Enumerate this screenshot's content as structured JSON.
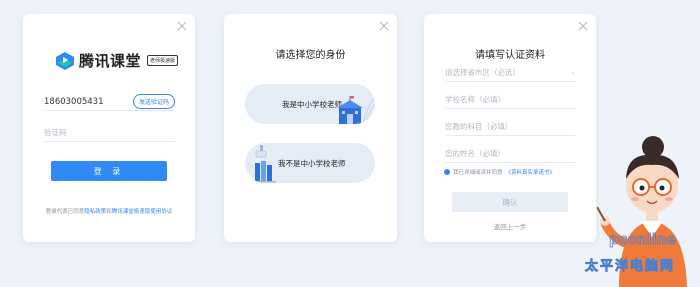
{
  "card_login": {
    "brand": "腾讯课堂",
    "badge": "老师极速版",
    "phone_value": "18603005431",
    "send_code_label": "发送验证码",
    "code_placeholder": "验证码",
    "login_label": "登 录",
    "agreement_prefix": "登录代表已同意",
    "privacy_link": "隐私政策",
    "and": "和",
    "service_link": "腾讯课堂极速版使用协议"
  },
  "card_identity": {
    "title": "请选择您的身份",
    "options": [
      {
        "label": "我是中小学校老师"
      },
      {
        "label": "我不是中小学校老师"
      }
    ]
  },
  "card_info": {
    "title": "请填写认证资料",
    "fields": [
      {
        "placeholder": "请选择省市区（必选）",
        "has_dropdown": true
      },
      {
        "placeholder": "学校名称（必填）"
      },
      {
        "placeholder": "您教的科目（必填）"
      },
      {
        "placeholder": "您的姓名（必填）"
      }
    ],
    "agreement_prefix": "我已详细阅读并同意",
    "agreement_link": "《资料真实承诺书》",
    "confirm_label": "确认",
    "back_label": "返回上一步"
  },
  "watermark": {
    "text": "pconline",
    "subtext": "太平洋电脑网"
  },
  "colors": {
    "background": "#eef3f9",
    "accent": "#2f8af5",
    "role_bg": "#e4ecf6",
    "disabled_bg": "#e8eef6"
  },
  "icons": [
    "close-icon",
    "tencent-logo-icon",
    "chevron-down-icon",
    "check-icon"
  ]
}
